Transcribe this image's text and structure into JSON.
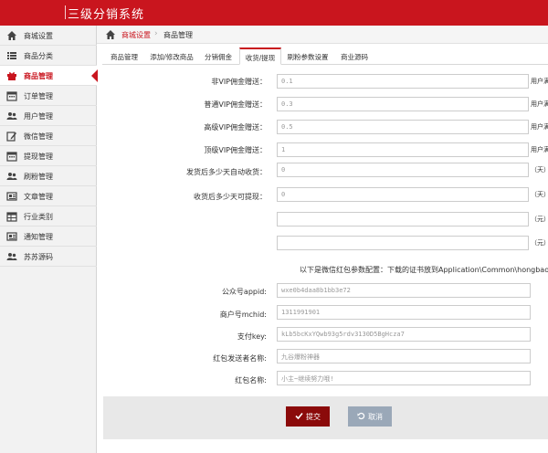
{
  "app": {
    "title": "三级分销系统"
  },
  "sidebar": {
    "items": [
      {
        "label": "商城设置",
        "icon": "home-icon"
      },
      {
        "label": "商品分类",
        "icon": "list-icon"
      },
      {
        "label": "商品管理",
        "icon": "gift-icon",
        "active": true
      },
      {
        "label": "订单管理",
        "icon": "calendar-icon"
      },
      {
        "label": "用户管理",
        "icon": "users-icon"
      },
      {
        "label": "微信管理",
        "icon": "edit-icon"
      },
      {
        "label": "提现管理",
        "icon": "calendar-icon"
      },
      {
        "label": "刷粉管理",
        "icon": "users-icon"
      },
      {
        "label": "文章管理",
        "icon": "newspaper-icon"
      },
      {
        "label": "行业类别",
        "icon": "table-icon"
      },
      {
        "label": "通知管理",
        "icon": "newspaper-icon"
      },
      {
        "label": "苏苏源码",
        "icon": "users-icon"
      }
    ]
  },
  "breadcrumb": {
    "level1": "商城设置",
    "separator": "›",
    "level2": "商品管理"
  },
  "tabs": [
    {
      "label": "商品管理"
    },
    {
      "label": "添加/修改商品"
    },
    {
      "label": "分销佣金"
    },
    {
      "label": "收货/提现",
      "active": true
    },
    {
      "label": "刷粉参数设置"
    },
    {
      "label": "商业源码"
    }
  ],
  "form": {
    "vip1_label": "非VIP佣金赠送：",
    "vip1_value": "0.1",
    "vip1_suffix": "用户满",
    "vip2_label": "普通VIP佣金赠送：",
    "vip2_value": "0.3",
    "vip2_suffix": "用户满",
    "vip3_label": "高级VIP佣金赠送：",
    "vip3_value": "0.5",
    "vip3_suffix": "用户满",
    "vip4_label": "顶级VIP佣金赠送：",
    "vip4_value": "1",
    "vip4_suffix": "用户满",
    "autoreceive_label": "发货后多少天自动收货：",
    "autoreceive_value": "0",
    "autoreceive_suffix": "（天）",
    "withdraw_days_label": "收货后多少天可提现：",
    "withdraw_days_value": "0",
    "withdraw_days_suffix": "（天）",
    "yuan1_value": "",
    "yuan1_suffix": "（元）",
    "yuan2_value": "",
    "yuan2_suffix": "（元）",
    "wechat_note": "以下是微信红包参数配置：下载的证书放到Application\\Common\\hongbao\\文件夹",
    "appid_label": "公众号appid:",
    "appid_value": "wxe0b4daa8b1bb3e72",
    "mchid_label": "商户号mchid:",
    "mchid_value": "1311991901",
    "paykey_label": "支付key:",
    "paykey_value": "kLb5bcKxYQwb93g5rdv3130D5BgHcza7",
    "sender_label": "红包发送者名称:",
    "sender_value": "九谷爆粉神器",
    "redpack_label": "红包名称:",
    "redpack_value": "小主~继续努力哦!"
  },
  "actions": {
    "submit_label": "提交",
    "cancel_label": "取消"
  },
  "colors": {
    "brand": "#c9151e",
    "submit": "#8b0a0a",
    "cancel": "#9aa8b8"
  }
}
